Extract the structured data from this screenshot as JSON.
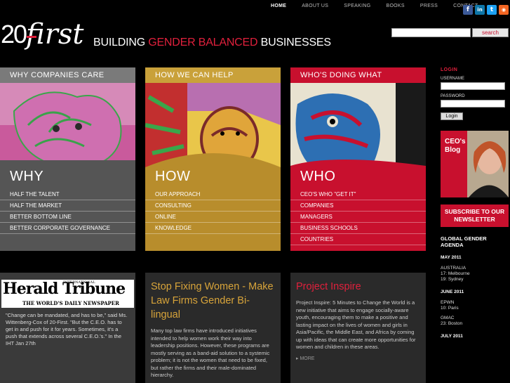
{
  "nav": {
    "items": [
      "HOME",
      "ABOUT US",
      "SPEAKING",
      "BOOKS",
      "PRESS",
      "CONTACT"
    ],
    "active": "HOME"
  },
  "social": {
    "icons": [
      "facebook-icon",
      "linkedin-icon",
      "twitter-icon",
      "rss-icon"
    ],
    "glyphs": [
      "f",
      "in",
      "t",
      "◉"
    ],
    "colors": [
      "#3b5998",
      "#0e76a8",
      "#1da1f2",
      "#f26522"
    ]
  },
  "brand": {
    "logo_num": "20",
    "logo_word": "first",
    "tagline_a": "BUILDING ",
    "tagline_hl": "GENDER BALANCED",
    "tagline_b": " BUSINESSES",
    "accent": "#e0203c"
  },
  "search": {
    "value": "",
    "button": "search"
  },
  "columns": [
    {
      "head": "WHY COMPANIES CARE",
      "big": "WHY",
      "items": [
        "HALF THE TALENT",
        "HALF THE MARKET",
        "BETTER BOTTOM LINE",
        "BETTER CORPORATE GOVERNANCE"
      ]
    },
    {
      "head": "HOW WE CAN HELP",
      "big": "HOW",
      "items": [
        "OUR APPROACH",
        "CONSULTING",
        "ONLINE",
        "KNOWLEDGE"
      ]
    },
    {
      "head": "WHO'S DOING WHAT",
      "big": "WHO",
      "items": [
        "CEO'S WHO \"GET IT\"",
        "COMPANIES",
        "MANAGERS",
        "BUSINESS SCHOOLS",
        "COUNTRIES"
      ]
    }
  ],
  "press": {
    "masthead_a": "Herald",
    "masthead_intl": "INTERNATIONAL",
    "masthead_b": "Tribune",
    "masthead_sub": "THE WORLD'S DAILY NEWSPAPER",
    "quote": "\"Change can be mandated, and has to be,\" said Ms. Wittenberg-Cox of 20-First. \"But the C.E.O. has to get in and push for it for years. Sometimes, it's a push that extends across several C.E.O.'s.\" In the IHT Jan 27th"
  },
  "article": {
    "title": "Stop Fixing Women - Make Law Firms Gender Bi-lingual",
    "text": "Many top law firms have introduced initiatives intended to help women work their way into leadership positions. However, these programs are mostly serving as a band-aid solution to a systemic problem; it is not the women that need to be fixed, but rather the firms and their male-dominated hierarchy."
  },
  "project": {
    "title": "Project Inspire",
    "text": "Project Inspire: 5 Minutes to Change the World is a new initiative that aims to engage socially-aware youth, encouraging them to make a positive and lasting impact on the lives of women and girls in Asia/Pacific, the Middle East, and Africa by coming up with ideas that can create more opportunities for women and children in these areas.",
    "more": "MORE"
  },
  "sidebar": {
    "login_title": "LOGIN",
    "username_label": "USERNAME",
    "password_label": "PASSWORD",
    "login_button": "Login",
    "blog_title_a": "CEO's",
    "blog_title_b": "Blog",
    "subscribe": "SUBSCRIBE TO OUR NEWSLETTER",
    "agenda_title": "GLOBAL GENDER AGENDA",
    "agenda": [
      {
        "month": "MAY 2011",
        "lines": [
          "AUSTRALIA",
          "17: Melbourne",
          "19: Sydney"
        ]
      },
      {
        "month": "JUNE 2011",
        "lines": [
          "EPWN",
          "10: Paris",
          "",
          "GMAC",
          "23: Boston"
        ]
      },
      {
        "month": "JULY 2011",
        "lines": []
      }
    ]
  }
}
